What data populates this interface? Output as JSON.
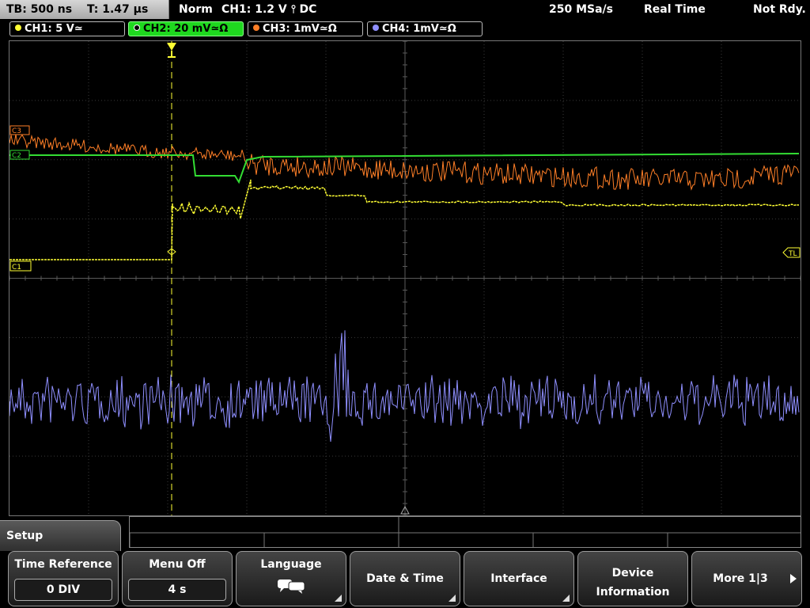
{
  "status": {
    "timebase": "TB: 500 ns",
    "trigger_time": "T: 1.47 µs",
    "mode": "Norm",
    "trigger": "CH1: 1.2 V ⫯ DC",
    "sample_rate": "250 MSa/s",
    "acq_mode": "Real Time",
    "state": "Not Rdy."
  },
  "channels": [
    {
      "label": "CH1: 5 V≃",
      "color": "#ffff33"
    },
    {
      "label": "CH2: 20 mV≃Ω",
      "color": "#33dd33",
      "active": true
    },
    {
      "label": "CH3: 1mV≃Ω",
      "color": "#ff7f27"
    },
    {
      "label": "CH4: 1mV≃Ω",
      "color": "#8f8fff"
    }
  ],
  "markers": {
    "c3": "C3",
    "c2": "C2",
    "c1": "C1",
    "trigger_level": "TL"
  },
  "menu": {
    "title": "Setup",
    "softkeys": [
      {
        "label": "Time Reference",
        "value": "0 DIV"
      },
      {
        "label": "Menu Off",
        "value": "4 s"
      },
      {
        "label": "Language",
        "icon": "speech-bubble-icon"
      },
      {
        "label": "Date & Time"
      },
      {
        "label": "Interface"
      },
      {
        "label": "Device",
        "label2": "Information"
      },
      {
        "label": "More 1|3"
      }
    ]
  }
}
